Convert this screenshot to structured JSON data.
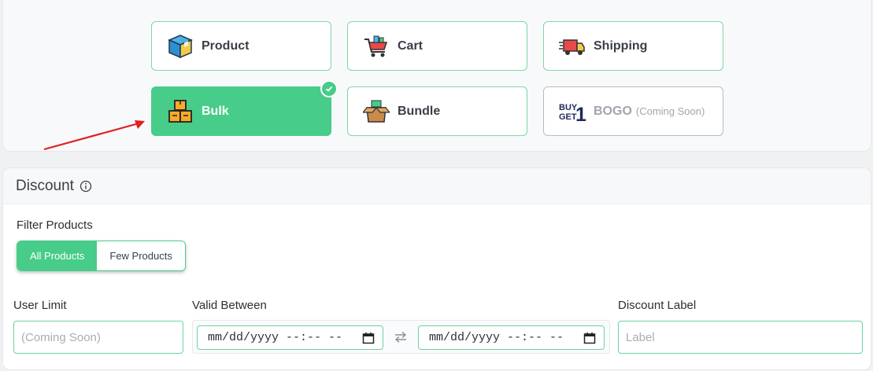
{
  "discount_types": [
    {
      "label": "Product",
      "icon": "product-box-icon",
      "state": "normal"
    },
    {
      "label": "Cart",
      "icon": "shopping-cart-icon",
      "state": "normal"
    },
    {
      "label": "Shipping",
      "icon": "delivery-truck-icon",
      "state": "normal"
    },
    {
      "label": "Bulk",
      "icon": "stacked-boxes-icon",
      "state": "active"
    },
    {
      "label": "Bundle",
      "icon": "open-box-icon",
      "state": "normal"
    },
    {
      "label": "BOGO",
      "sub": "(Coming Soon)",
      "icon": "buy-get-one-icon",
      "state": "disabled"
    }
  ],
  "bogo_icon_text": {
    "line1": "BUY",
    "line2": "GET",
    "num": "1"
  },
  "discount_section": {
    "title": "Discount",
    "filter_label": "Filter Products",
    "filter_options": [
      "All Products",
      "Few Products"
    ],
    "filter_selected": "All Products",
    "user_limit_label": "User Limit",
    "user_limit_placeholder": "(Coming Soon)",
    "valid_between_label": "Valid Between",
    "date_placeholder": "mm/dd/yyyy --:-- --",
    "discount_label_label": "Discount Label",
    "discount_label_placeholder": "Label"
  },
  "colors": {
    "accent": "#47cc89",
    "arrow": "#e02020"
  }
}
